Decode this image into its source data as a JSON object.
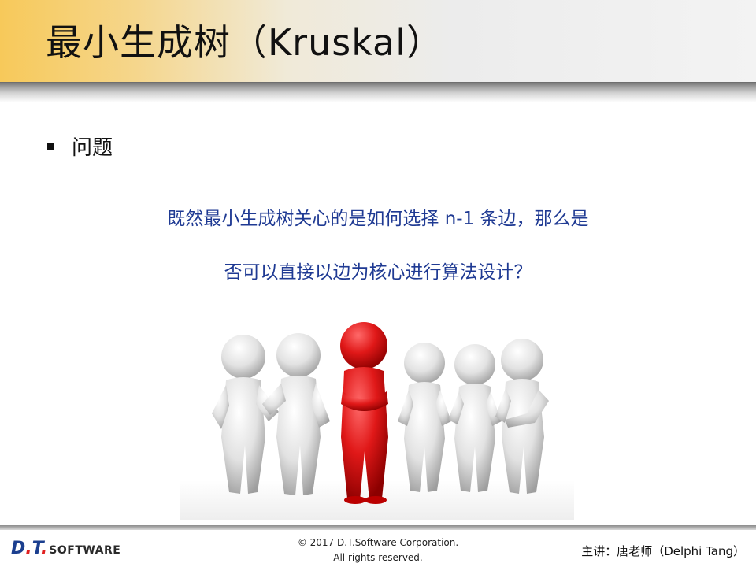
{
  "slide": {
    "title": "最小生成树（Kruskal）",
    "bullet": "问题",
    "question_line1": "既然最小生成树关心的是如何选择 n-1 条边，那么是",
    "question_line2": "否可以直接以边为核心进行算法设计？",
    "colors": {
      "question_text": "#1f3a93",
      "highlight_figure": "#d81e1e",
      "header_gold": "#f7c95a"
    }
  },
  "footer": {
    "logo_prefix": "D",
    "logo_dot1": ".",
    "logo_t": "T",
    "logo_dot2": ".",
    "logo_software": "SOFTWARE",
    "copyright_line1": "© 2017 D.T.Software Corporation.",
    "copyright_line2": "All rights reserved.",
    "speaker": "主讲：唐老师（Delphi Tang）"
  }
}
